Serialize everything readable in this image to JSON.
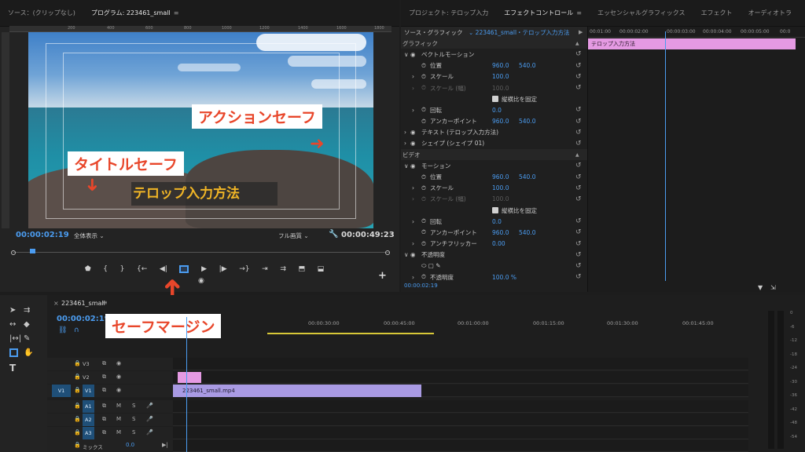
{
  "program": {
    "tabs": [
      "ソース：(クリップなし)",
      "プログラム: 223461_small"
    ],
    "ruler_ticks": [
      "200",
      "400",
      "600",
      "800",
      "1000",
      "1200",
      "1400",
      "1600",
      "1800"
    ],
    "telop_text": "テロップ入力方法",
    "callout_action": "アクションセーフ",
    "callout_title": "タイトルセーフ",
    "current_tc": "00:00:02:19",
    "zoom_select": "全体表示",
    "quality_select": "フル画質",
    "duration_tc": "00:00:49:23",
    "accent": "#4b9cf0"
  },
  "effects": {
    "tabs": [
      "プロジェクト: テロップ入力",
      "エフェクトコントロール",
      "エッセンシャルグラフィックス",
      "エフェクト",
      "オーディオトラ"
    ],
    "source_label": "ソース・グラフィック",
    "source_value": "223461_small・テロップ入力方法",
    "rows": [
      {
        "type": "sec",
        "label": "グラフィック",
        "indent": 2
      },
      {
        "label": "ベクトルモーション",
        "indent": 16,
        "arrow": "∨",
        "eye": true
      },
      {
        "label": "位置",
        "indent": 26,
        "v1": "960.0",
        "v2": "540.0",
        "sw": true
      },
      {
        "label": "スケール",
        "indent": 26,
        "v1": "100.0",
        "sw": true,
        "arrow": "›"
      },
      {
        "label": "スケール (幅)",
        "indent": 26,
        "v1": "100.0",
        "dim": true,
        "sw": true,
        "arrow": "›"
      },
      {
        "label": "縦横比を固定",
        "indent": 116,
        "check": true
      },
      {
        "label": "回転",
        "indent": 26,
        "v1": "0.0",
        "sw": true,
        "arrow": "›"
      },
      {
        "label": "アンカーポイント",
        "indent": 26,
        "v1": "960.0",
        "v2": "540.0",
        "sw": true
      },
      {
        "label": "テキスト (テロップ入力方法)",
        "indent": 16,
        "arrow": "›",
        "eye": true
      },
      {
        "label": "シェイプ (シェイプ 01)",
        "indent": 16,
        "arrow": "›",
        "eye": true
      },
      {
        "type": "sec",
        "label": "ビデオ",
        "indent": 2
      },
      {
        "label": "モーション",
        "indent": 16,
        "arrow": "∨",
        "eye": false
      },
      {
        "label": "位置",
        "indent": 26,
        "v1": "960.0",
        "v2": "540.0",
        "sw": true
      },
      {
        "label": "スケール",
        "indent": 26,
        "v1": "100.0",
        "sw": true,
        "arrow": "›"
      },
      {
        "label": "スケール (幅)",
        "indent": 26,
        "v1": "100.0",
        "dim": true,
        "sw": true,
        "arrow": "›"
      },
      {
        "label": "縦横比を固定",
        "indent": 116,
        "check": true
      },
      {
        "label": "回転",
        "indent": 26,
        "v1": "0.0",
        "sw": true,
        "arrow": "›"
      },
      {
        "label": "アンカーポイント",
        "indent": 26,
        "v1": "960.0",
        "v2": "540.0",
        "sw": true
      },
      {
        "label": "アンチフリッカー",
        "indent": 26,
        "v1": "0.00",
        "sw": true,
        "arrow": "›"
      },
      {
        "label": "不透明度",
        "indent": 16,
        "arrow": "∨",
        "eye": false
      },
      {
        "label": "",
        "indent": 26,
        "shapes": true
      },
      {
        "label": "不透明度",
        "indent": 26,
        "v1": "100.0 %",
        "sw": true,
        "arrow": "›"
      }
    ],
    "ruler": [
      "00:01:00",
      "00:00:02:00",
      "00:00:03:00",
      "00:00:04:00",
      "00:00:05:00",
      "00:0"
    ],
    "clip_label": "テロップ入力方法",
    "footer_tc": "00:00:02:19"
  },
  "timeline": {
    "sequence_tab": "223461_small",
    "current_tc": "00:00:02:19",
    "ruler": [
      "00:00:30:00",
      "00:00:45:00",
      "00:01:00:00",
      "00:01:15:00",
      "00:01:30:00",
      "00:01:45:00"
    ],
    "tracks_video": [
      "V3",
      "V2",
      "V1"
    ],
    "source_v": "V1",
    "tracks_audio": [
      "A1",
      "A2",
      "A3"
    ],
    "mix_label": "ミックス",
    "mix_value": "0.0",
    "clip_video": "223461_small.mp4",
    "callout": "セーフマージン"
  },
  "meters": {
    "ticks": [
      "0",
      "-6",
      "-12",
      "-18",
      "-24",
      "-30",
      "-36",
      "-42",
      "-48",
      "-54"
    ]
  }
}
